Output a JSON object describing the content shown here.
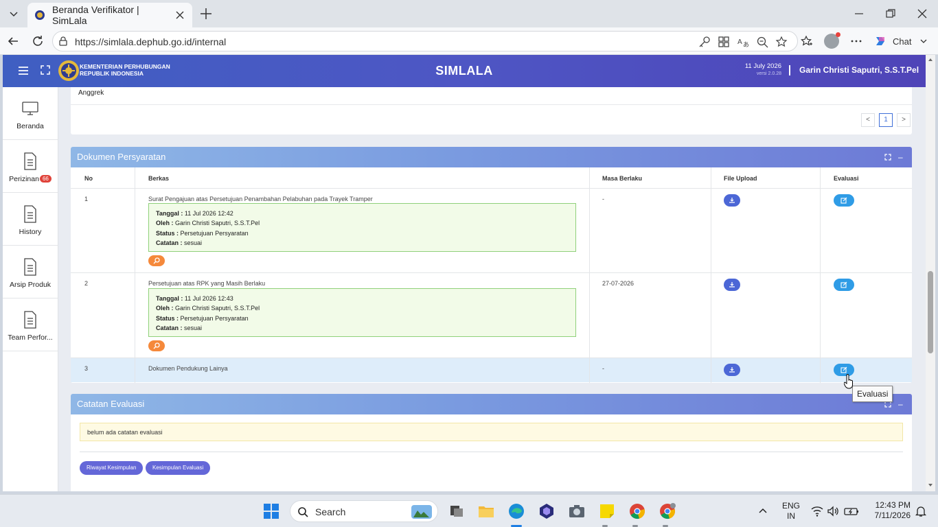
{
  "browser": {
    "tab_title": "Beranda Verifikator | SimLala",
    "url": "https://simlala.dephub.go.id/internal",
    "chat_label": "Chat"
  },
  "app": {
    "ministry_line1": "KEMENTERIAN PERHUBUNGAN",
    "ministry_line2": "REPUBLIK INDONESIA",
    "title": "SIMLALA",
    "date": "11 July 2026",
    "version": "versi 2.0.28",
    "user": "Garin Christi Saputri, S.S.T.Pel",
    "accent": "#4e56c4"
  },
  "sidebar": {
    "items": [
      {
        "label": "Beranda",
        "icon": "monitor-icon"
      },
      {
        "label": "Perizinan",
        "icon": "document-icon",
        "badge": "66"
      },
      {
        "label": "History",
        "icon": "document-icon"
      },
      {
        "label": "Arsip Produk",
        "icon": "document-icon"
      },
      {
        "label": "Team Perfor...",
        "icon": "document-icon"
      }
    ]
  },
  "top_card": {
    "cell_text": "Anggrek",
    "pager": {
      "prev": "<",
      "page": "1",
      "next": ">"
    }
  },
  "dokumen": {
    "title": "Dokumen Persyaratan",
    "columns": [
      "No",
      "Berkas",
      "Masa Berlaku",
      "File Upload",
      "Evaluasi"
    ],
    "rows": [
      {
        "no": "1",
        "berkas": "Surat Pengajuan atas Persetujuan Penambahan Pelabuhan pada Trayek Tramper",
        "tanggal_label": "Tanggal :",
        "tanggal": "11 Jul 2026 12:42",
        "oleh_label": "Oleh :",
        "oleh": "Garin Christi Saputri, S.S.T.Pel",
        "status_label": "Status :",
        "status": "Persetujuan Persyaratan",
        "catatan_label": "Catatan :",
        "catatan": "sesuai",
        "masa": "-"
      },
      {
        "no": "2",
        "berkas": "Persetujuan atas RPK yang Masih Berlaku",
        "tanggal_label": "Tanggal :",
        "tanggal": "11 Jul 2026 12:43",
        "oleh_label": "Oleh :",
        "oleh": "Garin Christi Saputri, S.S.T.Pel",
        "status_label": "Status :",
        "status": "Persetujuan Persyaratan",
        "catatan_label": "Catatan :",
        "catatan": "sesuai",
        "masa": "27-07-2026"
      },
      {
        "no": "3",
        "berkas": "Dokumen Pendukung Lainya",
        "masa": "-"
      }
    ],
    "tooltip": "Evaluasi"
  },
  "catatan": {
    "title": "Catatan Evaluasi",
    "note": "belum ada catatan evaluasi",
    "buttons": [
      "Riwayat Kesimpulan",
      "Kesimpulan Evaluasi"
    ]
  },
  "taskbar": {
    "search_placeholder": "Search",
    "lang_line1": "ENG",
    "lang_line2": "IN",
    "time": "12:43 PM",
    "date": "7/11/2026"
  }
}
